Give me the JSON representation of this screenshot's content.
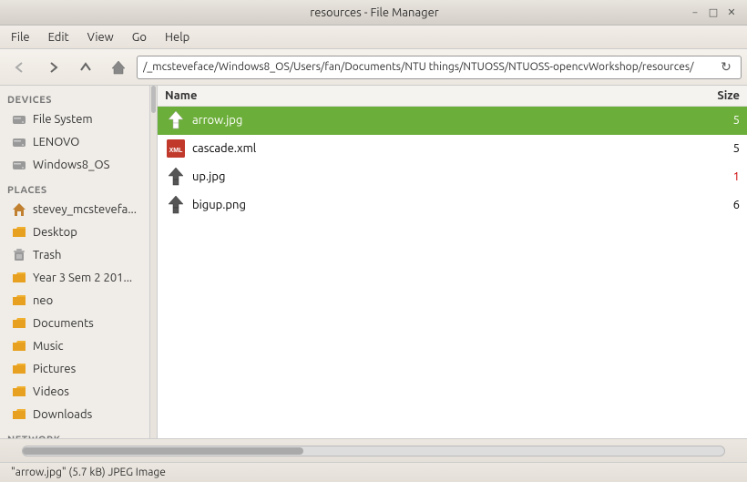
{
  "titlebar": {
    "title": "resources - File Manager",
    "btn_minimize": "−",
    "btn_maximize": "□",
    "btn_close": "✕"
  },
  "menubar": {
    "items": [
      {
        "label": "File"
      },
      {
        "label": "Edit"
      },
      {
        "label": "View"
      },
      {
        "label": "Go"
      },
      {
        "label": "Help"
      }
    ]
  },
  "toolbar": {
    "address": "/_mcsteveface/Windows8_OS/Users/fan/Documents/NTU things/NTUOSS/NTUOSS-opencvWorkshop/resources/"
  },
  "sidebar": {
    "devices_header": "DEVICES",
    "places_header": "PLACES",
    "network_header": "NETWORK",
    "devices": [
      {
        "label": "File System",
        "icon": "harddrive"
      },
      {
        "label": "LENOVO",
        "icon": "harddrive"
      },
      {
        "label": "Windows8_OS",
        "icon": "harddrive"
      }
    ],
    "places": [
      {
        "label": "stevey_mcstevefa...",
        "icon": "home"
      },
      {
        "label": "Desktop",
        "icon": "folder"
      },
      {
        "label": "Trash",
        "icon": "trash"
      },
      {
        "label": "Year 3 Sem 2 201...",
        "icon": "folder"
      },
      {
        "label": "neo",
        "icon": "folder"
      },
      {
        "label": "Documents",
        "icon": "folder"
      },
      {
        "label": "Music",
        "icon": "folder"
      },
      {
        "label": "Pictures",
        "icon": "folder"
      },
      {
        "label": "Videos",
        "icon": "folder"
      },
      {
        "label": "Downloads",
        "icon": "folder"
      }
    ]
  },
  "file_list": {
    "col_name": "Name",
    "col_size": "Size",
    "files": [
      {
        "name": "arrow.jpg",
        "size": "5",
        "type": "jpg",
        "selected": true
      },
      {
        "name": "cascade.xml",
        "size": "5",
        "type": "xml",
        "selected": false
      },
      {
        "name": "up.jpg",
        "size": "1",
        "type": "jpg",
        "selected": false,
        "size_red": true
      },
      {
        "name": "bigup.png",
        "size": "6",
        "type": "png",
        "selected": false
      }
    ]
  },
  "statusbar": {
    "info": "\"arrow.jpg\" (5.7 kB) JPEG Image"
  }
}
